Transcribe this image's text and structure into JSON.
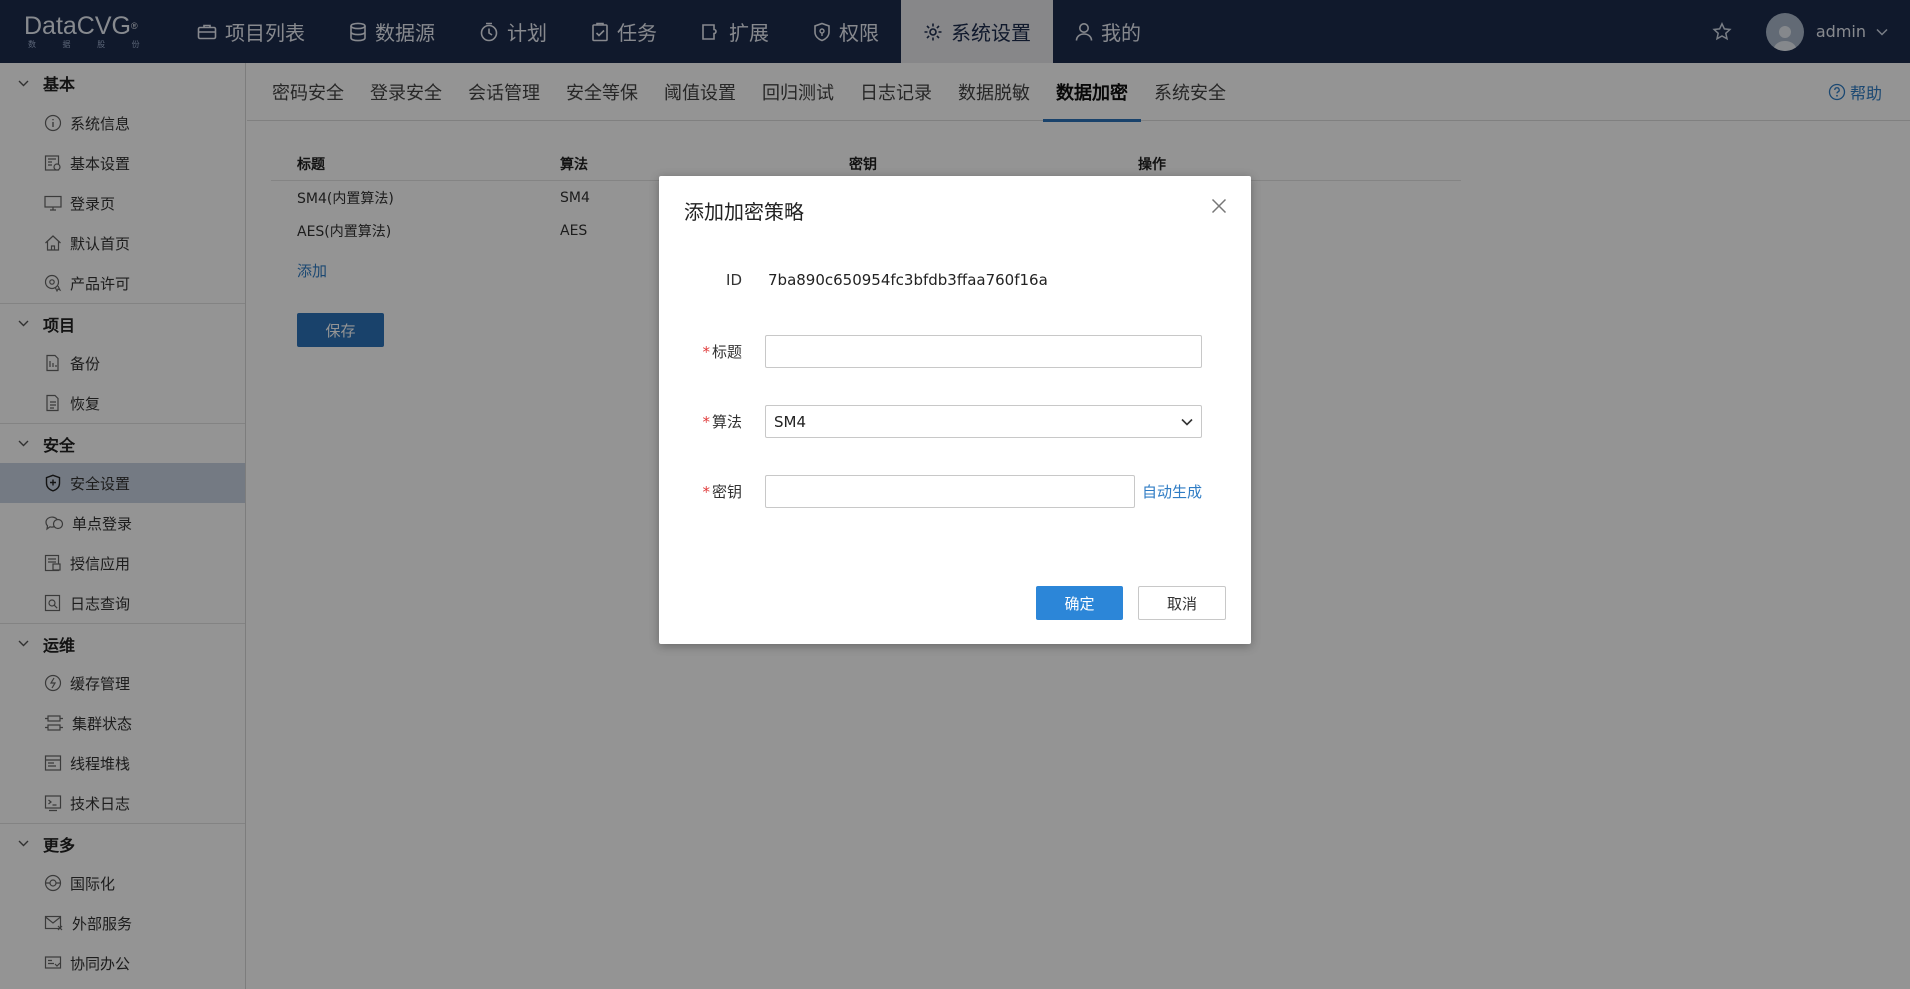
{
  "brand": {
    "name": "DataCVG",
    "reg": "®",
    "sub": "数 据 股 份"
  },
  "topnav": [
    {
      "label": "项目列表",
      "icon": "briefcase-icon"
    },
    {
      "label": "数据源",
      "icon": "database-icon"
    },
    {
      "label": "计划",
      "icon": "timer-icon"
    },
    {
      "label": "任务",
      "icon": "clipboard-icon"
    },
    {
      "label": "扩展",
      "icon": "plugin-icon"
    },
    {
      "label": "权限",
      "icon": "shield-icon"
    },
    {
      "label": "系统设置",
      "icon": "gear-icon",
      "active": true
    },
    {
      "label": "我的",
      "icon": "user-icon"
    }
  ],
  "user": {
    "name": "admin"
  },
  "sidebar": {
    "groups": [
      {
        "title": "基本",
        "items": [
          {
            "label": "系统信息",
            "icon": "info-icon"
          },
          {
            "label": "基本设置",
            "icon": "settings-doc-icon"
          },
          {
            "label": "登录页",
            "icon": "monitor-icon"
          },
          {
            "label": "默认首页",
            "icon": "home-icon"
          },
          {
            "label": "产品许可",
            "icon": "license-icon"
          }
        ]
      },
      {
        "title": "项目",
        "items": [
          {
            "label": "备份",
            "icon": "backup-icon"
          },
          {
            "label": "恢复",
            "icon": "restore-icon"
          }
        ]
      },
      {
        "title": "安全",
        "items": [
          {
            "label": "安全设置",
            "icon": "shield-plus-icon",
            "active": true
          },
          {
            "label": "单点登录",
            "icon": "chat-icon"
          },
          {
            "label": "授信应用",
            "icon": "app-icon"
          },
          {
            "label": "日志查询",
            "icon": "log-search-icon"
          }
        ]
      },
      {
        "title": "运维",
        "items": [
          {
            "label": "缓存管理",
            "icon": "cache-icon"
          },
          {
            "label": "集群状态",
            "icon": "cluster-icon"
          },
          {
            "label": "线程堆栈",
            "icon": "stack-icon"
          },
          {
            "label": "技术日志",
            "icon": "terminal-icon"
          }
        ]
      },
      {
        "title": "更多",
        "items": [
          {
            "label": "国际化",
            "icon": "globe-icon"
          },
          {
            "label": "外部服务",
            "icon": "mail-icon"
          },
          {
            "label": "协同办公",
            "icon": "collab-icon"
          }
        ]
      }
    ]
  },
  "subnav": {
    "tabs": [
      "密码安全",
      "登录安全",
      "会话管理",
      "安全等保",
      "阈值设置",
      "回归测试",
      "日志记录",
      "数据脱敏",
      "数据加密",
      "系统安全"
    ],
    "active_index": 8,
    "help": "帮助"
  },
  "table": {
    "headers": [
      "标题",
      "算法",
      "密钥",
      "操作"
    ],
    "rows": [
      [
        "SM4(内置算法)",
        "SM4",
        "",
        ""
      ],
      [
        "AES(内置算法)",
        "AES",
        "",
        ""
      ]
    ],
    "add_label": "添加",
    "save_label": "保存"
  },
  "modal": {
    "title": "添加加密策略",
    "id_label": "ID",
    "id_value": "7ba890c650954fc3bfdb3ffaa760f16a",
    "required_mark": "*",
    "title_label": "标题",
    "title_value": "",
    "algo_label": "算法",
    "algo_value": "SM4",
    "key_label": "密钥",
    "key_value": "",
    "auto_generate": "自动生成",
    "ok": "确定",
    "cancel": "取消"
  }
}
